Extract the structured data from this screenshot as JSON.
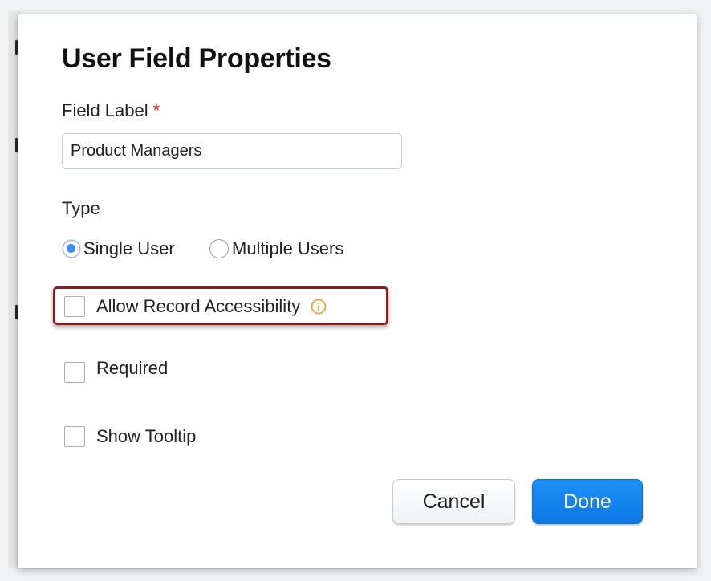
{
  "dialog": {
    "title": "User Field Properties",
    "field_label": {
      "label": "Field Label",
      "required_marker": "*",
      "value": "Product Managers"
    },
    "type": {
      "label": "Type",
      "options": [
        {
          "label": "Single User",
          "selected": true
        },
        {
          "label": "Multiple Users",
          "selected": false
        }
      ]
    },
    "checkboxes": {
      "allow_record_accessibility": {
        "label": "Allow Record Accessibility",
        "checked": false,
        "icon": "info-icon"
      },
      "required": {
        "label": "Required",
        "checked": false
      },
      "show_tooltip": {
        "label": "Show Tooltip",
        "checked": false
      }
    },
    "buttons": {
      "cancel": "Cancel",
      "done": "Done"
    }
  },
  "colors": {
    "accent": "#0b78e6",
    "required_star": "#e0221d",
    "info_icon": "#f0a23a",
    "highlight_border": "#8e1a1d"
  }
}
